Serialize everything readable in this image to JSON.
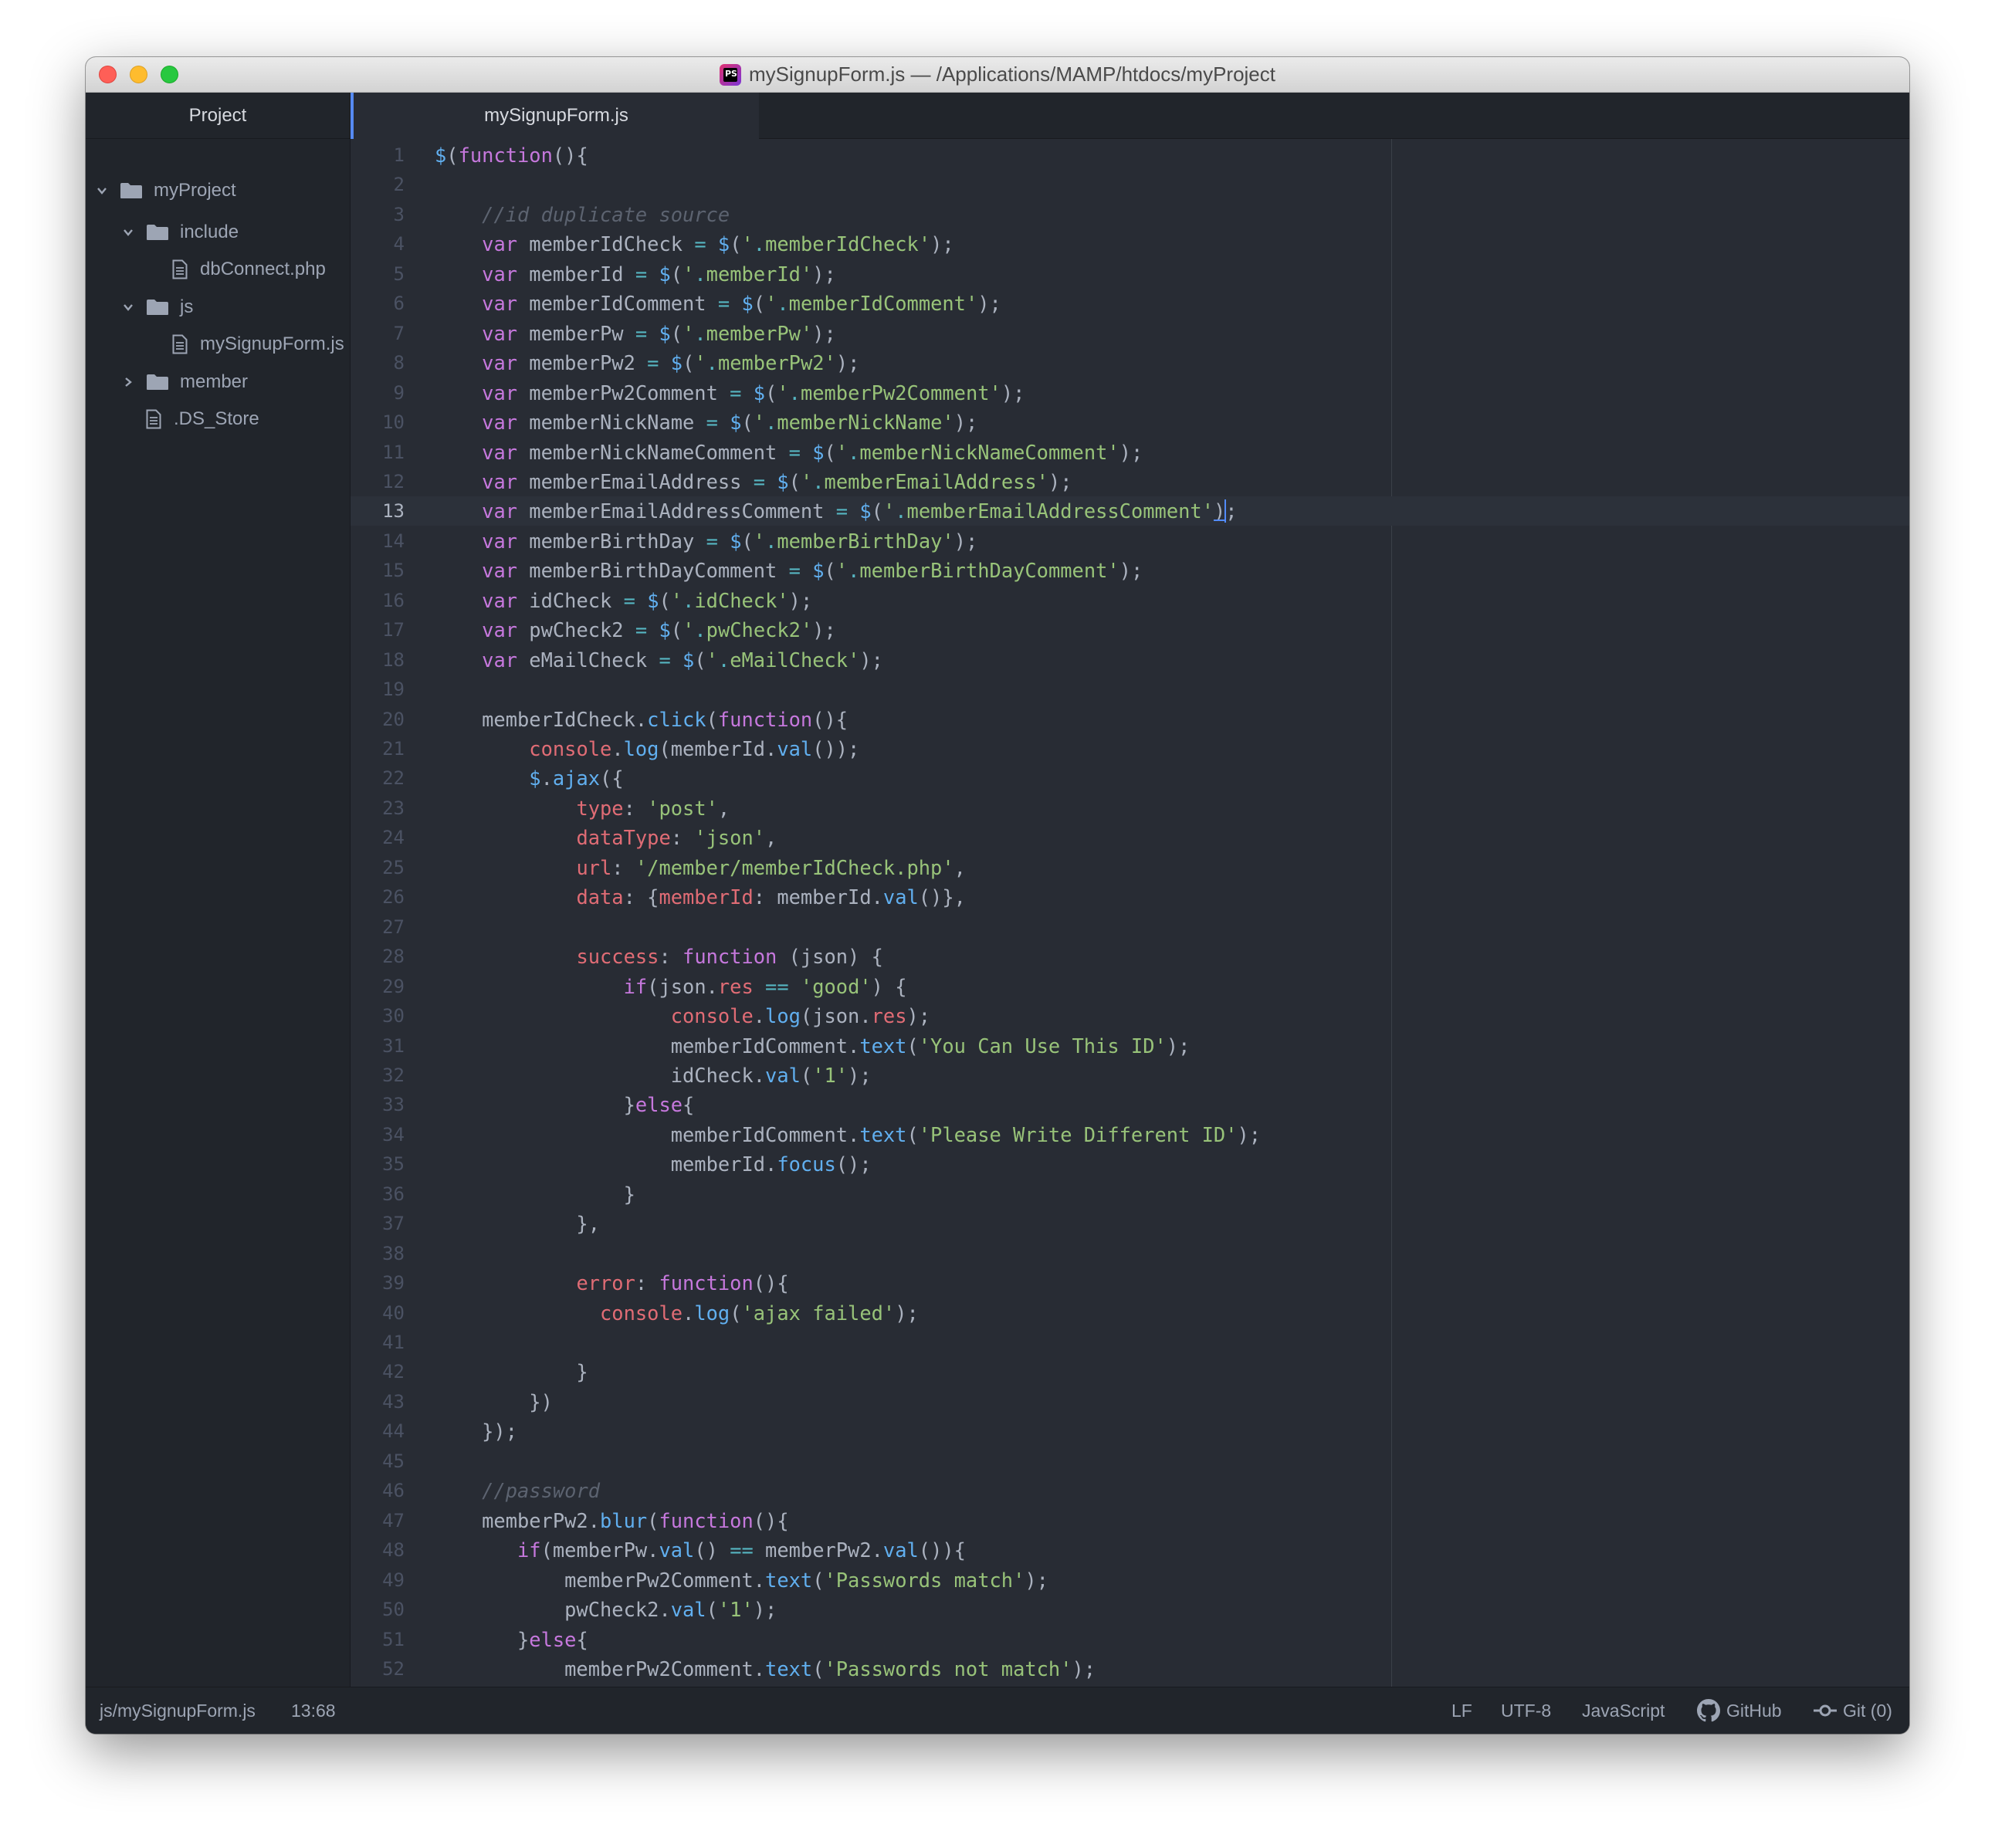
{
  "window": {
    "title": "mySignupForm.js — /Applications/MAMP/htdocs/myProject",
    "app_icon_text": "PS"
  },
  "sidebar": {
    "header": "Project",
    "tree": [
      {
        "label": "myProject",
        "type": "folder",
        "expanded": true,
        "depth": 0
      },
      {
        "label": "include",
        "type": "folder",
        "expanded": true,
        "depth": 1
      },
      {
        "label": "dbConnect.php",
        "type": "file",
        "depth": 2
      },
      {
        "label": "js",
        "type": "folder",
        "expanded": true,
        "depth": 1
      },
      {
        "label": "mySignupForm.js",
        "type": "file",
        "depth": 2
      },
      {
        "label": "member",
        "type": "folder",
        "expanded": false,
        "depth": 1
      },
      {
        "label": ".DS_Store",
        "type": "file",
        "depth": 1
      }
    ]
  },
  "tabs": [
    {
      "label": "mySignupForm.js",
      "active": true
    }
  ],
  "editor": {
    "current_line": 13,
    "lines": [
      "$(function(){",
      "",
      "    //id duplicate source",
      "    var memberIdCheck = $('.memberIdCheck');",
      "    var memberId = $('.memberId');",
      "    var memberIdComment = $('.memberIdComment');",
      "    var memberPw = $('.memberPw');",
      "    var memberPw2 = $('.memberPw2');",
      "    var memberPw2Comment = $('.memberPw2Comment');",
      "    var memberNickName = $('.memberNickName');",
      "    var memberNickNameComment = $('.memberNickNameComment');",
      "    var memberEmailAddress = $('.memberEmailAddress');",
      "    var memberEmailAddressComment = $('.memberEmailAddressComment');",
      "    var memberBirthDay = $('.memberBirthDay');",
      "    var memberBirthDayComment = $('.memberBirthDayComment');",
      "    var idCheck = $('.idCheck');",
      "    var pwCheck2 = $('.pwCheck2');",
      "    var eMailCheck = $('.eMailCheck');",
      "",
      "    memberIdCheck.click(function(){",
      "        console.log(memberId.val());",
      "        $.ajax({",
      "            type: 'post',",
      "            dataType: 'json',",
      "            url: '/member/memberIdCheck.php',",
      "            data: {memberId: memberId.val()},",
      "",
      "            success: function (json) {",
      "                if(json.res == 'good') {",
      "                    console.log(json.res);",
      "                    memberIdComment.text('You Can Use This ID');",
      "                    idCheck.val('1');",
      "                }else{",
      "                    memberIdComment.text('Please Write Different ID');",
      "                    memberId.focus();",
      "                }",
      "            },",
      "",
      "            error: function(){",
      "              console.log('ajax failed');",
      "",
      "            }",
      "        })",
      "    });",
      "",
      "    //password",
      "    memberPw2.blur(function(){",
      "       if(memberPw.val() == memberPw2.val()){",
      "           memberPw2Comment.text('Passwords match');",
      "           pwCheck2.val('1');",
      "       }else{",
      "           memberPw2Comment.text('Passwords not match');",
      ""
    ]
  },
  "statusbar": {
    "file_path": "js/mySignupForm.js",
    "cursor_position": "13:68",
    "line_ending": "LF",
    "encoding": "UTF-8",
    "grammar": "JavaScript",
    "github": "GitHub",
    "git": "Git (0)"
  },
  "colors": {
    "background": "#282c34",
    "sidebar": "#21252b",
    "keyword": "#c678dd",
    "string": "#98c379",
    "function": "#61afef",
    "property": "#e06c75",
    "comment": "#5c6370",
    "accent": "#568af2"
  }
}
